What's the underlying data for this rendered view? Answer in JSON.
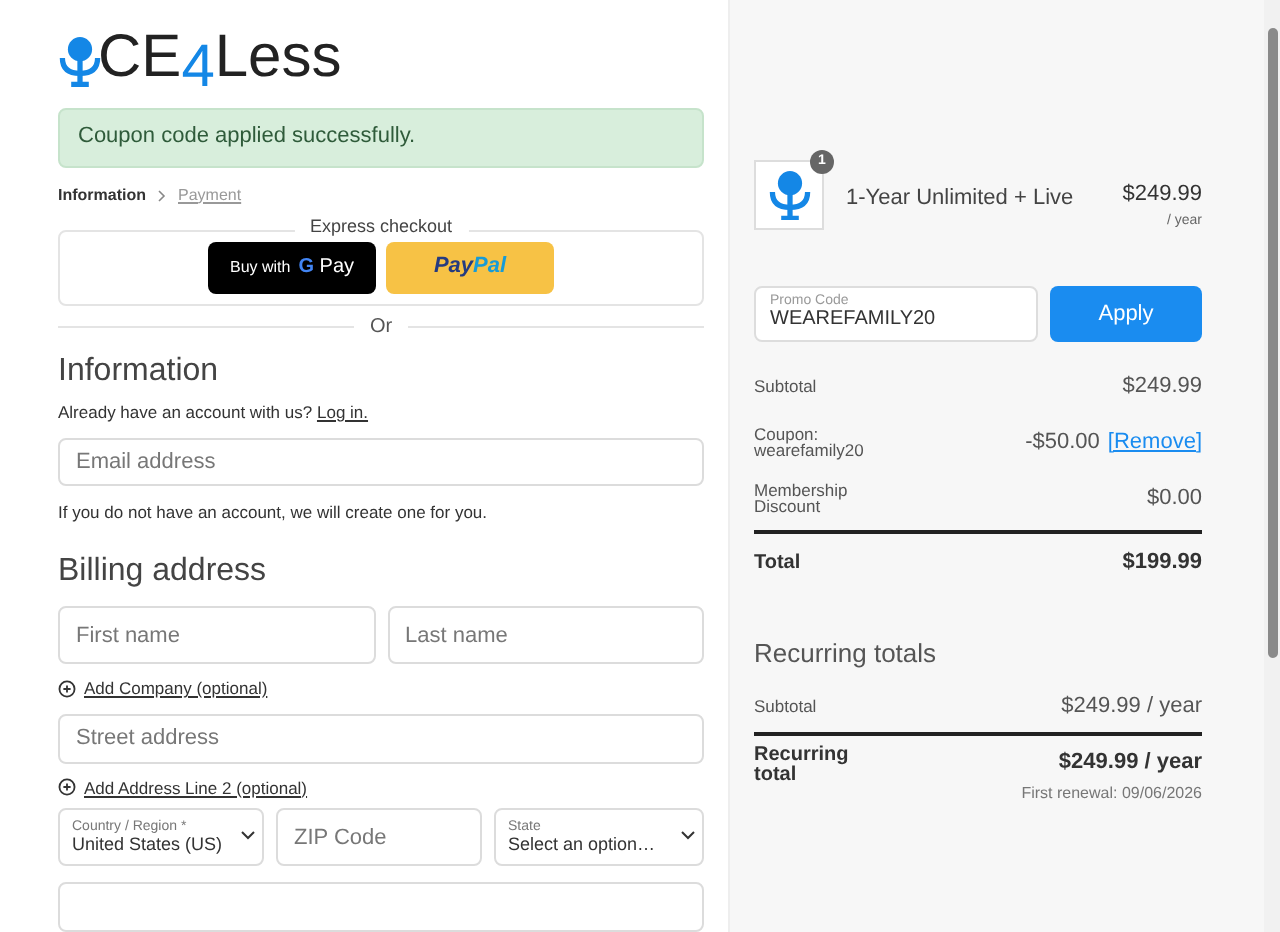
{
  "logo": {
    "parts": [
      {
        "text": "CE",
        "accent": false
      },
      {
        "text": "4",
        "accent": true
      },
      {
        "text": "Less",
        "accent": false
      }
    ]
  },
  "notice": "Coupon code applied successfully.",
  "breadcrumb": [
    {
      "label": "Information",
      "selected": true
    },
    {
      "label": "Payment",
      "selected": false
    }
  ],
  "express": {
    "title": "Express checkout",
    "gpay": {
      "prefix": "Buy with",
      "g": "G",
      "pay": "Pay"
    },
    "paypal": {
      "pay": "Pay",
      "pal": "Pal"
    },
    "or": "Or"
  },
  "information": {
    "heading": "Information",
    "prompt": "Already have an account with us?",
    "login": "Log in.",
    "email_placeholder": "Email address",
    "note": "If you do not have an account, we will create one for you."
  },
  "billing": {
    "heading": "Billing address",
    "first_placeholder": "First name",
    "last_placeholder": "Last name",
    "add_company": "Add Company (optional)",
    "street_placeholder": "Street address",
    "add_line2": "Add Address Line 2 (optional)",
    "country": {
      "label": "Country / Region *",
      "value": "United States (US)"
    },
    "zip_placeholder": "ZIP Code",
    "state": {
      "label": "State",
      "value": "Select an option…"
    }
  },
  "order": {
    "item": {
      "quantity": "1",
      "name": "1-Year Unlimited + Live",
      "price": "$249.99",
      "period": "/ year"
    },
    "promo": {
      "label": "Promo Code",
      "value": "WEAREFAMILY20",
      "button": "Apply"
    },
    "rows": [
      {
        "label": "Subtotal",
        "value": "$249.99",
        "kind": "plain"
      },
      {
        "label": "Coupon: wearefamily20",
        "value": "-$50.00",
        "link": "[Remove]",
        "kind": "plain"
      },
      {
        "label": "Membership Discount",
        "value": "$0.00",
        "kind": "plain"
      },
      {
        "label": "Total",
        "value": "$199.99",
        "kind": "total"
      }
    ],
    "recurring": {
      "heading": "Recurring totals",
      "subtotal_label": "Subtotal",
      "subtotal_value": "$249.99 / year",
      "total_label": "Recurring total",
      "total_value": "$249.99 / year",
      "renewal": "First renewal: 09/06/2026"
    }
  }
}
